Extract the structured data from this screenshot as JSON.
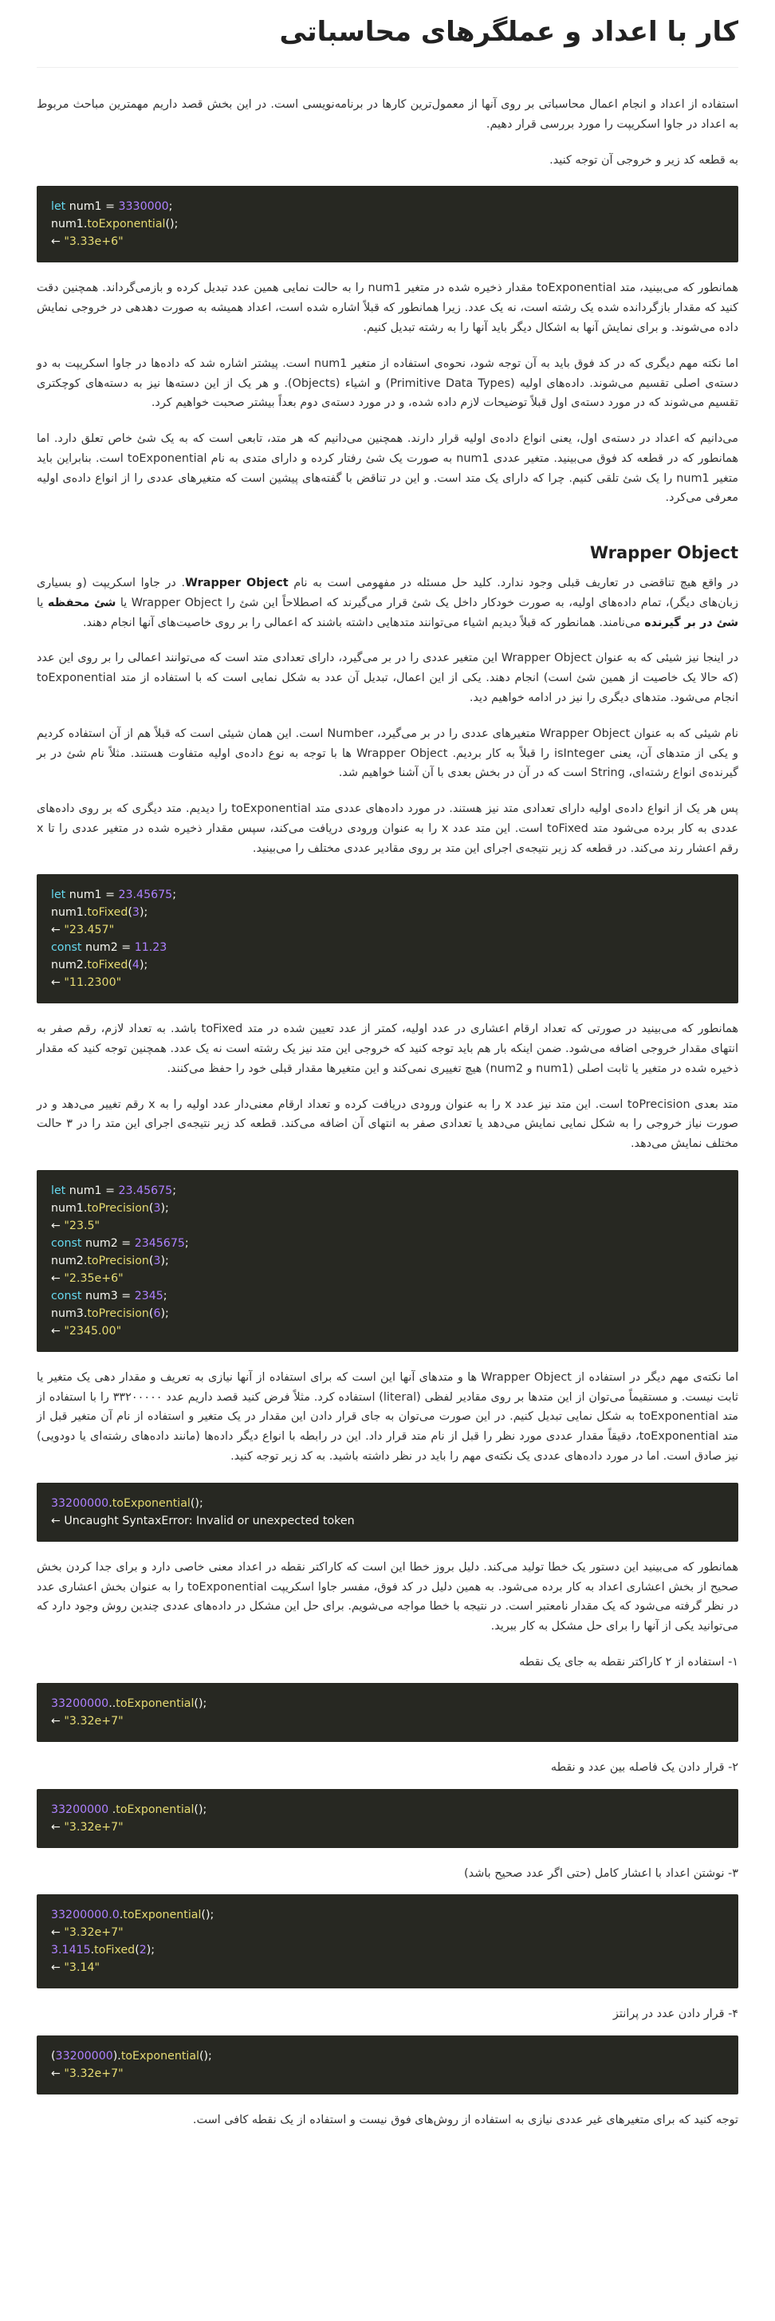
{
  "title": "کار با اعداد و عملگرهای محاسباتی",
  "p1": "استفاده از اعداد و انجام اعمال محاسباتی بر روی آنها از معمول‌ترین کارها در برنامه‌نویسی است. در این بخش قصد داریم مهمترین مباحث مربوط به اعداد در جاوا اسکریپت را مورد بررسی قرار دهیم.",
  "p2": "به قطعه کد زیر و خروجی آن توجه کنید.",
  "p3": "همانطور که می‌بینید، متد toExponential مقدار ذخیره شده در متغیر num1 را به حالت نمایی همین عدد تبدیل کرده و بازمی‌گرداند. همچنین دقت کنید که مقدار بازگردانده شده یک رشته است، نه یک عدد. زیرا همانطور که قبلاً اشاره شده است، اعداد همیشه به صورت دهدهی در خروجی نمایش داده می‌شوند. و برای نمایش آنها به اشکال دیگر باید آنها را به رشته تبدیل کنیم.",
  "p4": "اما نکته مهم دیگری که در کد فوق باید به آن توجه شود، نحوه‌ی استفاده از متغیر num1 است. پیشتر اشاره شد که داده‌ها در جاوا اسکریپت به دو دسته‌ی اصلی تقسیم می‌شوند. داده‌های اولیه (Primitive Data Types) و اشیاء (Objects). و هر یک از این دسته‌ها نیز به دسته‌های کوچکتری تقسیم می‌شوند که در مورد دسته‌ی اول قبلاً توضیحات لازم داده شده، و در مورد دسته‌ی دوم بعداً بیشتر صحبت خواهیم کرد.",
  "p5": "می‌دانیم که اعداد در دسته‌ی اول، یعنی انواع داده‌ی اولیه قرار دارند. همچنین می‌دانیم که هر متد، تابعی است که به یک شئ خاص تعلق دارد. اما همانطور که در قطعه کد فوق می‌بینید. متغیر عددی num1 به صورت یک شئ رفتار کرده و دارای متدی به نام toExponential است. بنابراین باید متغیر num1 را یک شئ تلقی کنیم. چرا که دارای یک متد است. و این در تناقض با گفته‌های پیشین است که متغیرهای عددی را از انواع داده‌ی اولیه معرفی می‌کرد.",
  "h2": "Wrapper Object",
  "p6a": "در واقع هیچ تناقضی در تعاریف قبلی وجود ندارد. کلید حل مسئله در مفهومی است به نام ",
  "p6b": "Wrapper Object",
  "p6c": ". در جاوا اسکریپت (و بسیاری زبان‌های دیگر)، تمام داده‌های اولیه، به صورت خودکار داخل یک شئ قرار می‌گیرند که اصطلاحاً این شئ را Wrapper Object یا ",
  "p6d": "شئ محفظه",
  "p6e": " یا ",
  "p6f": "شئ در بر گیرنده",
  "p6g": " می‌نامند. همانطور که قبلاً دیدیم اشیاء می‌توانند متدهایی داشته باشند که اعمالی را بر روی خاصیت‌های آنها انجام دهند.",
  "p7": "در اینجا نیز شیئی که به عنوان Wrapper Object این متغیر عددی را در بر می‌گیرد، دارای تعدادی متد است که می‌توانند اعمالی را بر روی این عدد (که حالا یک خاصیت از همین شئ است) انجام دهند. یکی از این اعمال، تبدیل آن عدد به شکل نمایی است که با استفاده از متد toExponential انجام می‌شود. متدهای دیگری را نیز در ادامه خواهیم دید.",
  "p8": "نام شیئی که به عنوان Wrapper Object متغیرهای عددی را در بر می‌گیرد، Number است. این همان شیئی است که قبلاً هم از آن استفاده کردیم و یکی از متدهای آن، یعنی isInteger را قبلاً به کار بردیم. Wrapper Object ها با توجه به نوع داده‌ی اولیه متفاوت هستند. مثلاً نام شئ در بر گیرنده‌ی انواع رشته‌ای، String است که در آن در بخش بعدی با آن آشنا خواهیم شد.",
  "p9": "پس هر یک از انواع داده‌ی اولیه دارای تعدادی متد نیز هستند. در مورد داده‌های عددی متد toExponential را دیدیم. متد دیگری که بر روی داده‌های عددی به کار برده می‌شود متد toFixed است. این متد عدد x را به عنوان ورودی دریافت می‌کند، سپس مقدار ذخیره شده در متغیر عددی را تا x رقم اعشار رند می‌کند. در قطعه کد زیر نتیجه‌ی اجرای این متد بر روی مقادیر عددی مختلف را می‌بینید.",
  "p10": "همانطور که می‌بینید در صورتی که تعداد ارقام اعشاری در عدد اولیه، کمتر از عدد تعیین شده در متد toFixed باشد. به تعداد لازم، رقم صفر به انتهای مقدار خروجی اضافه می‌شود. ضمن اینکه بار هم باید توجه کنید که خروجی این متد نیز یک رشته است نه یک عدد. همچنین توجه کنید که مقدار ذخیره شده در متغیر یا ثابت اصلی (num1 و num2) هیچ تغییری نمی‌کند و این متغیرها مقدار قبلی خود را حفظ می‌کنند.",
  "p11": "متد بعدی toPrecision است. این متد نیز عدد x را به عنوان ورودی دریافت کرده و تعداد ارقام معنی‌دار عدد اولیه را به x رقم تغییر می‌دهد و در صورت نیاز خروجی را به شکل نمایی نمایش می‌دهد یا تعدادی صفر به انتهای آن اضافه می‌کند. قطعه کد زیر نتیجه‌ی اجرای این متد را در ۳ حالت مختلف نمایش می‌دهد.",
  "p12": "اما نکته‌ی مهم دیگر در استفاده از Wrapper Object ها و متدهای آنها این است که برای استفاده از آنها نیازی به تعریف و مقدار دهی یک متغیر یا ثابت نیست. و مستقیماً می‌توان از این متدها بر روی مقادیر لفظی (literal) استفاده کرد. مثلاً فرض کنید قصد داریم عدد ۳۳۲۰۰۰۰۰ را با استفاده از متد toExponential به شکل نمایی تبدیل کنیم. در این صورت می‌توان به جای قرار دادن این مقدار در یک متغیر و استفاده از نام آن متغیر قبل از متد toExponential، دقیقاً مقدار عددی مورد نظر را قبل از نام متد قرار داد. این در رابطه با انواع دیگر داده‌ها (مانند داده‌های رشته‌ای یا دودویی) نیز صادق است. اما در مورد داده‌های عددی یک نکته‌ی مهم را باید در نظر داشته باشید. به کد زیر توجه کنید.",
  "p13": "همانطور که می‌بینید این دستور یک خطا تولید می‌کند. دلیل بروز خطا این است که کاراکتر نقطه در اعداد معنی خاصی دارد و برای جدا کردن بخش صحیح از بخش اعشاری اعداد به کار برده می‌شود. به همین دلیل در کد فوق، مفسر جاوا اسکریپت toExponential را به عنوان بخش اعشاری عدد در نظر گرفته می‌شود که یک مقدار نامعتبر است. در نتیجه با خطا مواجه می‌شویم. برای حل این مشکل در داده‌های عددی چندین روش وجود دارد که می‌توانید یکی از آنها را برای حل مشکل به کار ببرید.",
  "note1": "۱- استفاده از ۲ کاراکتر نقطه به جای یک نقطه",
  "note2": "۲- قرار دادن یک فاصله بین عدد و نقطه",
  "note3": "۳- نوشتن اعداد با اعشار کامل (حتی اگر عدد صحیح باشد)",
  "note4": "۴- قرار دادن عدد در پرانتز",
  "p14": "توجه کنید که برای متغیرهای غیر عددی نیازی به استفاده از روش‌های فوق نیست و استفاده از یک نقطه کافی است.",
  "code_blocks": [
    [
      [
        [
          "kw",
          "let"
        ],
        [
          "plain",
          " num1 = "
        ],
        [
          "num",
          "3330000"
        ],
        [
          "plain",
          ";"
        ]
      ],
      [
        [
          "plain",
          "num1."
        ],
        [
          "fn",
          "toExponential"
        ],
        [
          "plain",
          "();"
        ]
      ],
      [
        [
          "plain",
          "← "
        ],
        [
          "str",
          "\"3.33e+6\""
        ]
      ]
    ],
    [
      [
        [
          "kw",
          "let"
        ],
        [
          "plain",
          " num1 = "
        ],
        [
          "num",
          "23.45675"
        ],
        [
          "plain",
          ";"
        ]
      ],
      [
        [
          "plain",
          "num1."
        ],
        [
          "fn",
          "toFixed"
        ],
        [
          "plain",
          "("
        ],
        [
          "num",
          "3"
        ],
        [
          "plain",
          ");"
        ]
      ],
      [
        [
          "plain",
          "← "
        ],
        [
          "str",
          "\"23.457\""
        ]
      ],
      [
        [
          "kw",
          "const"
        ],
        [
          "plain",
          " num2 = "
        ],
        [
          "num",
          "11.23"
        ]
      ],
      [
        [
          "plain",
          "num2."
        ],
        [
          "fn",
          "toFixed"
        ],
        [
          "plain",
          "("
        ],
        [
          "num",
          "4"
        ],
        [
          "plain",
          ");"
        ]
      ],
      [
        [
          "plain",
          "← "
        ],
        [
          "str",
          "\"11.2300\""
        ]
      ]
    ],
    [
      [
        [
          "kw",
          "let"
        ],
        [
          "plain",
          " num1 = "
        ],
        [
          "num",
          "23.45675"
        ],
        [
          "plain",
          ";"
        ]
      ],
      [
        [
          "plain",
          "num1."
        ],
        [
          "fn",
          "toPrecision"
        ],
        [
          "plain",
          "("
        ],
        [
          "num",
          "3"
        ],
        [
          "plain",
          ");"
        ]
      ],
      [
        [
          "plain",
          "← "
        ],
        [
          "str",
          "\"23.5\""
        ]
      ],
      [
        [
          "kw",
          "const"
        ],
        [
          "plain",
          " num2 = "
        ],
        [
          "num",
          "2345675"
        ],
        [
          "plain",
          ";"
        ]
      ],
      [
        [
          "plain",
          "num2."
        ],
        [
          "fn",
          "toPrecision"
        ],
        [
          "plain",
          "("
        ],
        [
          "num",
          "3"
        ],
        [
          "plain",
          ");"
        ]
      ],
      [
        [
          "plain",
          "← "
        ],
        [
          "str",
          "\"2.35e+6\""
        ]
      ],
      [
        [
          "kw",
          "const"
        ],
        [
          "plain",
          " num3 = "
        ],
        [
          "num",
          "2345"
        ],
        [
          "plain",
          ";"
        ]
      ],
      [
        [
          "plain",
          "num3."
        ],
        [
          "fn",
          "toPrecision"
        ],
        [
          "plain",
          "("
        ],
        [
          "num",
          "6"
        ],
        [
          "plain",
          ");"
        ]
      ],
      [
        [
          "plain",
          "← "
        ],
        [
          "str",
          "\"2345.00\""
        ]
      ]
    ],
    [
      [
        [
          "num",
          "33200000"
        ],
        [
          "plain",
          "."
        ],
        [
          "fn",
          "toExponential"
        ],
        [
          "plain",
          "();"
        ]
      ],
      [
        [
          "plain",
          "← Uncaught SyntaxError: Invalid or unexpected token"
        ]
      ]
    ],
    [
      [
        [
          "num",
          "33200000"
        ],
        [
          "plain",
          ".."
        ],
        [
          "fn",
          "toExponential"
        ],
        [
          "plain",
          "();"
        ]
      ],
      [
        [
          "plain",
          "← "
        ],
        [
          "str",
          "\"3.32e+7\""
        ]
      ]
    ],
    [
      [
        [
          "num",
          "33200000"
        ],
        [
          "plain",
          " ."
        ],
        [
          "fn",
          "toExponential"
        ],
        [
          "plain",
          "();"
        ]
      ],
      [
        [
          "plain",
          "← "
        ],
        [
          "str",
          "\"3.32e+7\""
        ]
      ]
    ],
    [
      [
        [
          "num",
          "33200000.0"
        ],
        [
          "plain",
          "."
        ],
        [
          "fn",
          "toExponential"
        ],
        [
          "plain",
          "();"
        ]
      ],
      [
        [
          "plain",
          "← "
        ],
        [
          "str",
          "\"3.32e+7\""
        ]
      ],
      [
        [
          "num",
          "3.1415"
        ],
        [
          "plain",
          "."
        ],
        [
          "fn",
          "toFixed"
        ],
        [
          "plain",
          "("
        ],
        [
          "num",
          "2"
        ],
        [
          "plain",
          ");"
        ]
      ],
      [
        [
          "plain",
          "← "
        ],
        [
          "str",
          "\"3.14\""
        ]
      ]
    ],
    [
      [
        [
          "plain",
          "("
        ],
        [
          "num",
          "33200000"
        ],
        [
          "plain",
          ")."
        ],
        [
          "fn",
          "toExponential"
        ],
        [
          "plain",
          "();"
        ]
      ],
      [
        [
          "plain",
          "← "
        ],
        [
          "str",
          "\"3.32e+7\""
        ]
      ]
    ]
  ]
}
